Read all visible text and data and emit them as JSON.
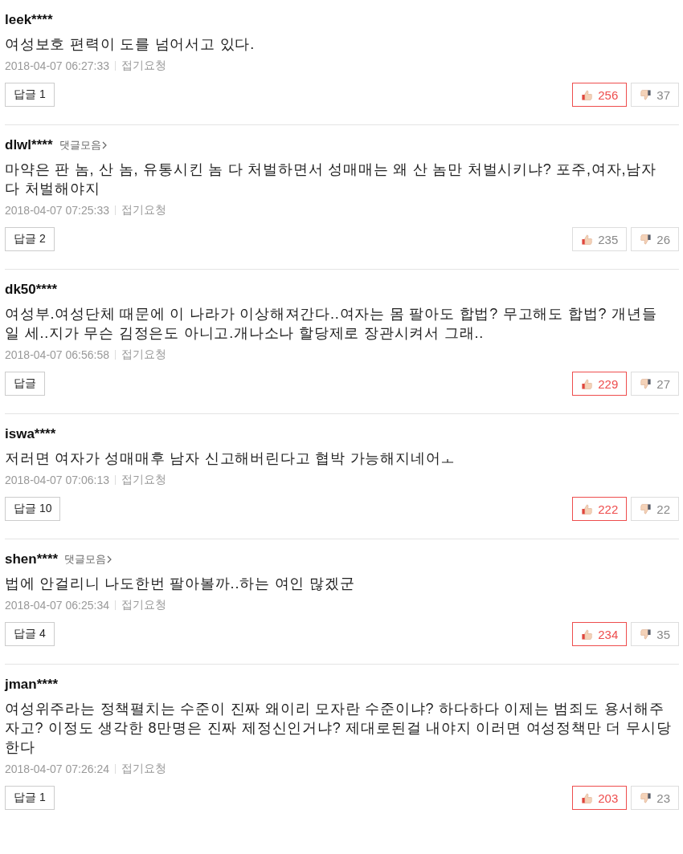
{
  "comments": [
    {
      "user": "leek****",
      "text": "여성보호 편력이 도를 넘어서고 있다.",
      "date": "2018-04-07 06:27:33",
      "report": "접기요청",
      "reply_label": "답글",
      "reply_count": "1",
      "likes": "256",
      "liked": true,
      "dislikes": "37"
    },
    {
      "user": "dlwl****",
      "collection_link": "댓글모음",
      "text": "마약은 판 놈, 산 놈, 유통시킨 놈 다 처벌하면서 성매매는 왜 산 놈만 처벌시키냐? 포주,여자,남자 다 처벌해야지",
      "date": "2018-04-07 07:25:33",
      "report": "접기요청",
      "reply_label": "답글",
      "reply_count": "2",
      "likes": "235",
      "liked": false,
      "dislikes": "26"
    },
    {
      "user": "dk50****",
      "text": "여성부.여성단체 때문에 이 나라가 이상해져간다..여자는 몸 팔아도 합법? 무고해도 합법? 개년들 일 세..지가 무슨 김정은도 아니고.개나소나 할당제로 장관시켜서 그래..",
      "date": "2018-04-07 06:56:58",
      "report": "접기요청",
      "reply_label": "답글",
      "likes": "229",
      "liked": true,
      "dislikes": "27"
    },
    {
      "user": "iswa****",
      "text": "저러면 여자가 성매매후 남자 신고해버린다고 협박 가능해지네어ㅗ",
      "date": "2018-04-07 07:06:13",
      "report": "접기요청",
      "reply_label": "답글",
      "reply_count": "10",
      "likes": "222",
      "liked": true,
      "dislikes": "22"
    },
    {
      "user": "shen****",
      "collection_link": "댓글모음",
      "text": "법에 안걸리니 나도한번 팔아볼까..하는 여인 많겠군",
      "date": "2018-04-07 06:25:34",
      "report": "접기요청",
      "reply_label": "답글",
      "reply_count": "4",
      "likes": "234",
      "liked": true,
      "dislikes": "35"
    },
    {
      "user": "jman****",
      "text": "여성위주라는 정책펼치는 수준이 진짜 왜이리 모자란 수준이냐? 하다하다 이제는 범죄도 용서해주자고? 이정도 생각한 8만명은 진짜 제정신인거냐? 제대로된걸 내야지 이러면 여성정책만 더 무시당한다",
      "date": "2018-04-07 07:26:24",
      "report": "접기요청",
      "reply_label": "답글",
      "reply_count": "1",
      "likes": "203",
      "liked": true,
      "dislikes": "23"
    }
  ]
}
